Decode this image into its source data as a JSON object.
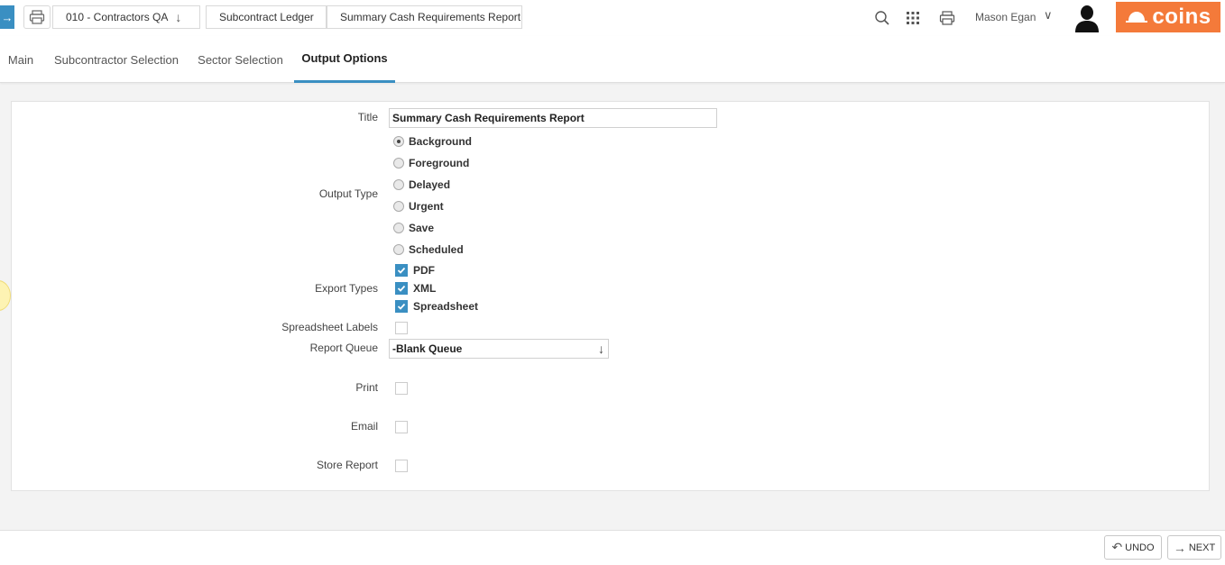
{
  "breadcrumbs": {
    "company": "010 - Contractors QA",
    "module": "Subcontract Ledger",
    "page": "Summary Cash Requirements Report"
  },
  "header": {
    "user_name": "Mason Egan",
    "logo_text": "coins",
    "accent_color": "#3a8fc2",
    "brand_color": "#f47a3a"
  },
  "tabs": [
    {
      "label": "Main"
    },
    {
      "label": "Subcontractor Selection"
    },
    {
      "label": "Sector Selection"
    },
    {
      "label": "Output Options",
      "active": true
    }
  ],
  "form": {
    "title_label": "Title",
    "title_value": "Summary Cash Requirements Report",
    "output_type_label": "Output Type",
    "output_types": [
      {
        "label": "Background",
        "checked": true
      },
      {
        "label": "Foreground",
        "checked": false
      },
      {
        "label": "Delayed",
        "checked": false
      },
      {
        "label": "Urgent",
        "checked": false
      },
      {
        "label": "Save",
        "checked": false
      },
      {
        "label": "Scheduled",
        "checked": false
      }
    ],
    "export_types_label": "Export Types",
    "export_types": [
      {
        "label": "PDF",
        "checked": true
      },
      {
        "label": "XML",
        "checked": true
      },
      {
        "label": "Spreadsheet",
        "checked": true
      }
    ],
    "spreadsheet_labels_label": "Spreadsheet Labels",
    "spreadsheet_labels_checked": false,
    "report_queue_label": "Report Queue",
    "report_queue_value": "-Blank Queue",
    "print_label": "Print",
    "email_label": "Email",
    "store_report_label": "Store Report"
  },
  "footer": {
    "undo_label": "UNDO",
    "next_label": "NEXT"
  }
}
